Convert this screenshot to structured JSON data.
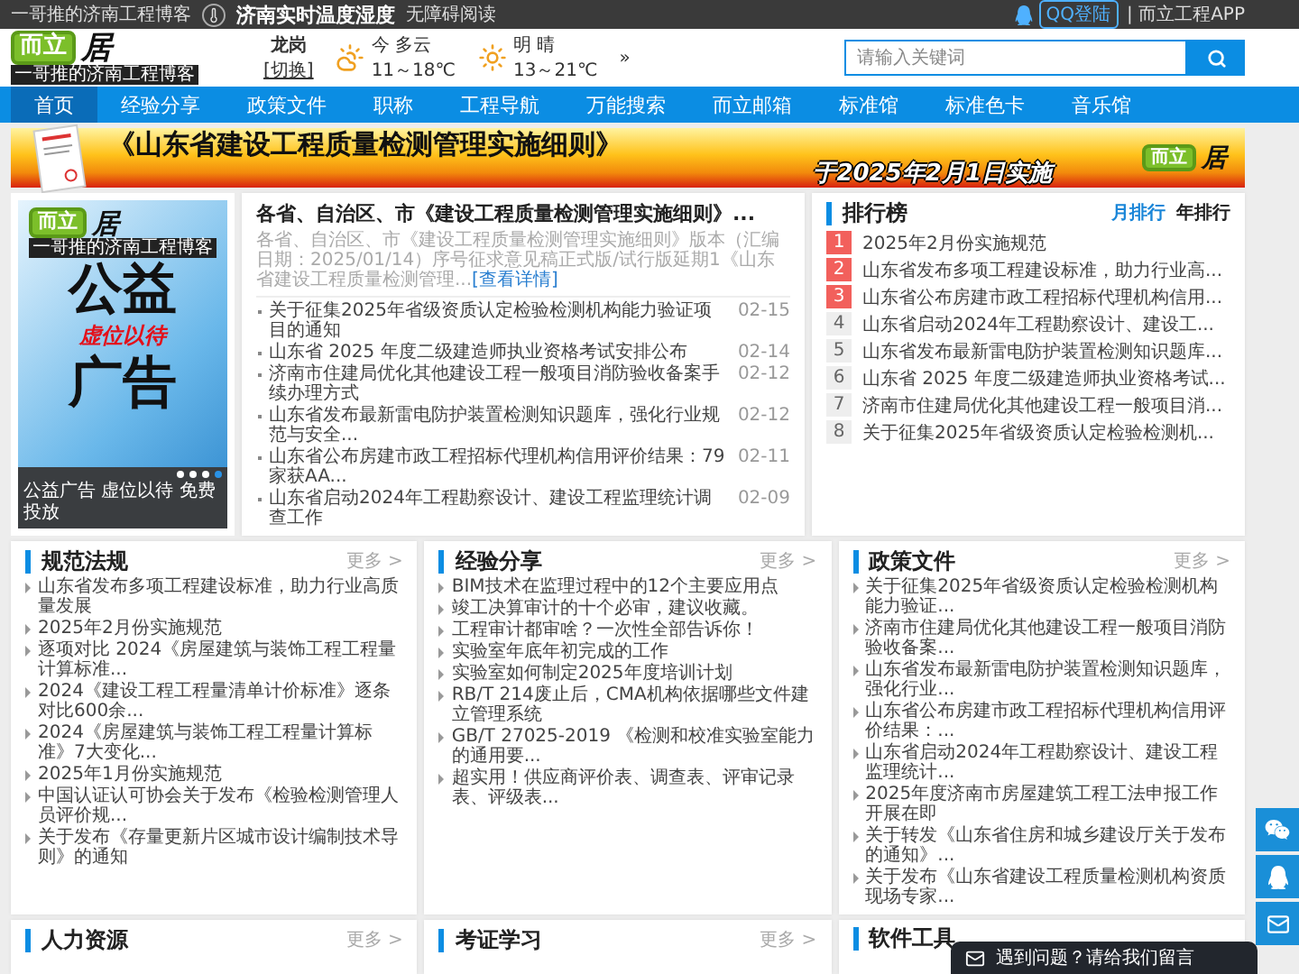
{
  "top_bar": {
    "tagline": "一哥推的济南工程博客",
    "weather_link": "济南实时温度湿度",
    "accessibility": "无障碍阅读",
    "login": "QQ登陆",
    "app": "| 而立工程APP"
  },
  "logo": {
    "mark": "而立",
    "glyph": "居",
    "slogan": "一哥推的济南工程博客"
  },
  "weather": {
    "city": "龙岗",
    "switch": "[切换]",
    "more": "»",
    "days": [
      {
        "kind": "cloudy",
        "label": "今 多云",
        "range": "11～18℃"
      },
      {
        "kind": "sunny",
        "label": "明 晴",
        "range": "13～21℃"
      }
    ]
  },
  "search": {
    "placeholder": "请输入关键词"
  },
  "nav": [
    {
      "label": "首页",
      "selected": true
    },
    {
      "label": "经验分享",
      "selected": false
    },
    {
      "label": "政策文件",
      "selected": false
    },
    {
      "label": "职称",
      "selected": false
    },
    {
      "label": "工程导航",
      "selected": false
    },
    {
      "label": "万能搜索",
      "selected": false
    },
    {
      "label": "而立邮箱",
      "selected": false
    },
    {
      "label": "标准馆",
      "selected": false
    },
    {
      "label": "标准色卡",
      "selected": false
    },
    {
      "label": "音乐馆",
      "selected": false
    }
  ],
  "banner": {
    "title": "《山东省建设工程质量检测管理实施细则》",
    "subtitle": "于2025年2月1日实施",
    "logo_mark": "而立",
    "logo_glyph": "居"
  },
  "slider": {
    "logo_mark": "而立",
    "logo_glyph": "居",
    "logo_slogan": "一哥推的济南工程博客",
    "heading_top": "公益",
    "slogan": "虚位以待",
    "heading_bottom": "广告",
    "caption": "公益广告 虚位以待 免费投放",
    "dots": [
      {
        "selected": false
      },
      {
        "selected": false
      },
      {
        "selected": false
      },
      {
        "selected": true
      }
    ]
  },
  "feature": {
    "headline": "各省、自治区、市《建设工程质量检测管理实施细则》...",
    "summary": "各省、自治区、市《建设工程质量检测管理实施细则》版本（汇编日期：2025/01/14）序号征求意见稿正式版/试行版延期1《山东省建设工程质量检测管理...",
    "link": "[查看详情]",
    "news": [
      {
        "title": "关于征集2025年省级资质认定检验检测机构能力验证项目的通知",
        "date": "02-15"
      },
      {
        "title": "山东省 2025 年度二级建造师执业资格考试安排公布",
        "date": "02-14"
      },
      {
        "title": "济南市住建局优化其他建设工程一般项目消防验收备案手续办理方式",
        "date": "02-12"
      },
      {
        "title": "山东省发布最新雷电防护装置检测知识题库，强化行业规范与安全...",
        "date": "02-12"
      },
      {
        "title": "山东省公布房建市政工程招标代理机构信用评价结果：79家获AA...",
        "date": "02-11"
      },
      {
        "title": "山东省启动2024年工程勘察设计、建设工程监理统计调查工作",
        "date": "02-09"
      }
    ]
  },
  "ranking": {
    "title": "排行榜",
    "tabs": [
      {
        "label": "月排行",
        "selected": true
      },
      {
        "label": "年排行",
        "selected": false
      }
    ],
    "items": [
      {
        "rank": "1",
        "top": true,
        "title": "2025年2月份实施规范"
      },
      {
        "rank": "2",
        "top": true,
        "title": "山东省发布多项工程建设标准，助力行业高..."
      },
      {
        "rank": "3",
        "top": true,
        "title": "山东省公布房建市政工程招标代理机构信用..."
      },
      {
        "rank": "4",
        "top": false,
        "title": "山东省启动2024年工程勘察设计、建设工..."
      },
      {
        "rank": "5",
        "top": false,
        "title": "山东省发布最新雷电防护装置检测知识题库..."
      },
      {
        "rank": "6",
        "top": false,
        "title": "山东省 2025 年度二级建造师执业资格考试..."
      },
      {
        "rank": "7",
        "top": false,
        "title": "济南市住建局优化其他建设工程一般项目消..."
      },
      {
        "rank": "8",
        "top": false,
        "title": "关于征集2025年省级资质认定检验检测机..."
      }
    ]
  },
  "sections": [
    {
      "title": "规范法规",
      "more": "更多 >",
      "items": [
        "山东省发布多项工程建设标准，助力行业高质量发展",
        "2025年2月份实施规范",
        "逐项对比 2024《房屋建筑与装饰工程工程量计算标准...",
        "2024《建设工程工程量清单计价标准》逐条对比600余...",
        "2024《房屋建筑与装饰工程工程量计算标准》7大变化...",
        "2025年1月份实施规范",
        "中国认证认可协会关于发布《检验检测管理人员评价规...",
        "关于发布《存量更新片区城市设计编制技术导则》的通知"
      ]
    },
    {
      "title": "经验分享",
      "more": "更多 >",
      "items": [
        "BIM技术在监理过程中的12个主要应用点",
        "竣工决算审计的十个必审，建议收藏。",
        "工程审计都审啥？一次性全部告诉你！",
        "实验室年底年初完成的工作",
        "实验室如何制定2025年度培训计划",
        "RB/T 214废止后，CMA机构依据哪些文件建立管理系统",
        "GB/T 27025-2019 《检测和校准实验室能力的通用要...",
        "超实用！供应商评价表、调查表、评审记录表、评级表..."
      ]
    },
    {
      "title": "政策文件",
      "more": "更多 >",
      "items": [
        "关于征集2025年省级资质认定检验检测机构能力验证...",
        "济南市住建局优化其他建设工程一般项目消防验收备案...",
        "山东省发布最新雷电防护装置检测知识题库，强化行业...",
        "山东省公布房建市政工程招标代理机构信用评价结果：...",
        "山东省启动2024年工程勘察设计、建设工程监理统计...",
        "2025年度济南市房屋建筑工程工法申报工作开展在即",
        "关于转发《山东省住房和城乡建设厅关于发布的通知》...",
        "关于发布《山东省建设工程质量检测机构资质现场专家..."
      ]
    }
  ],
  "more_sections": [
    {
      "title": "人力资源",
      "more": "更多 >"
    },
    {
      "title": "考证学习",
      "more": "更多 >"
    },
    {
      "title": "软件工具"
    }
  ],
  "float_buttons": [
    {
      "kind": "wechat"
    },
    {
      "kind": "qq"
    },
    {
      "kind": "mail"
    }
  ],
  "chat": {
    "text": "遇到问题？请给我们留言"
  }
}
